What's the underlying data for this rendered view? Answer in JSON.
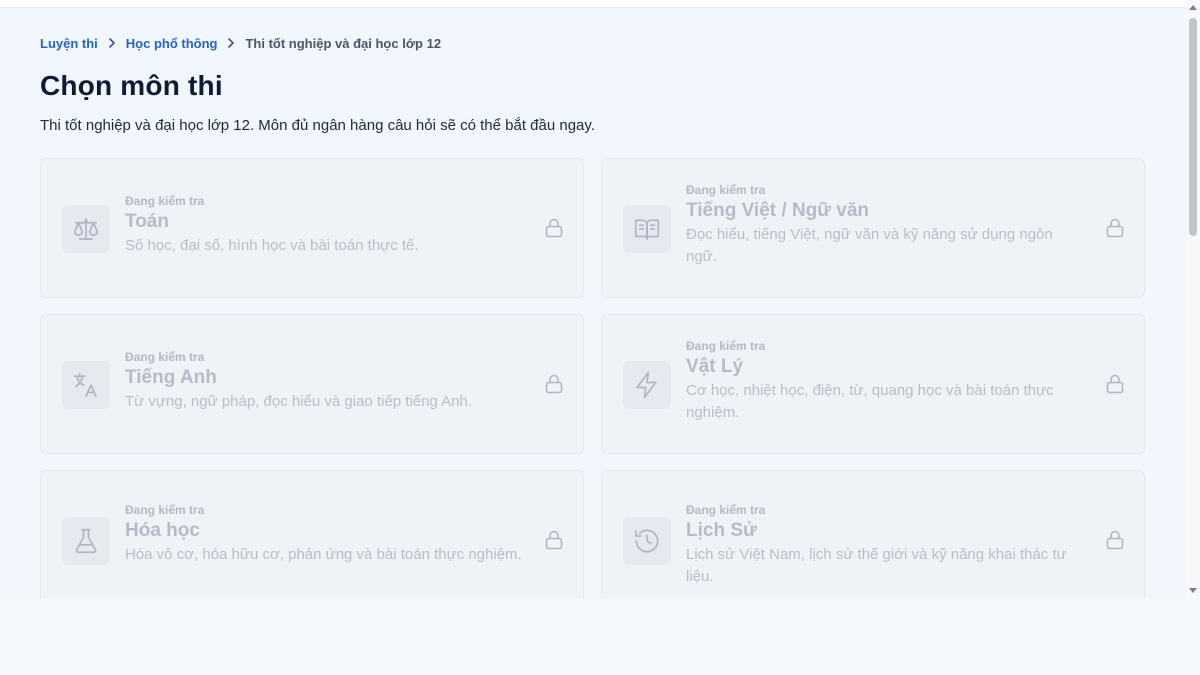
{
  "breadcrumb": {
    "items": [
      {
        "label": "Luyện thi",
        "link": true
      },
      {
        "label": "Học phổ thông",
        "link": true
      },
      {
        "label": "Thi tốt nghiệp và đại học lớp 12",
        "link": false
      }
    ]
  },
  "page": {
    "title": "Chọn môn thi",
    "subtitle": "Thi tốt nghiệp và đại học lớp 12. Môn đủ ngân hàng câu hỏi sẽ có thể bắt đầu ngay."
  },
  "subjects": [
    {
      "status": "Đang kiểm tra",
      "name": "Toán",
      "description": "Số học, đại số, hình học và bài toán thực tế.",
      "icon": "scale-icon",
      "locked": true
    },
    {
      "status": "Đang kiểm tra",
      "name": "Tiếng Việt / Ngữ văn",
      "description": "Đọc hiểu, tiếng Việt, ngữ văn và kỹ năng sử dụng ngôn ngữ.",
      "icon": "book-open-icon",
      "locked": true
    },
    {
      "status": "Đang kiểm tra",
      "name": "Tiếng Anh",
      "description": "Từ vựng, ngữ pháp, đọc hiểu và giao tiếp tiếng Anh.",
      "icon": "translate-icon",
      "locked": true
    },
    {
      "status": "Đang kiểm tra",
      "name": "Vật Lý",
      "description": "Cơ học, nhiệt học, điện, từ, quang học và bài toán thực nghiệm.",
      "icon": "lightning-icon",
      "locked": true
    },
    {
      "status": "Đang kiểm tra",
      "name": "Hóa học",
      "description": "Hóa vô cơ, hóa hữu cơ, phản ứng và bài toán thực nghiệm.",
      "icon": "flask-icon",
      "locked": true
    },
    {
      "status": "Đang kiểm tra",
      "name": "Lịch Sử",
      "description": "Lịch sử Việt Nam, lịch sử thế giới và kỹ năng khai thác tư liệu.",
      "icon": "history-icon",
      "locked": true
    }
  ],
  "colors": {
    "link": "#2563c9",
    "title": "#0f1b34",
    "card_bg": "#eff3f8",
    "disabled_text": "#b6bcc7"
  }
}
